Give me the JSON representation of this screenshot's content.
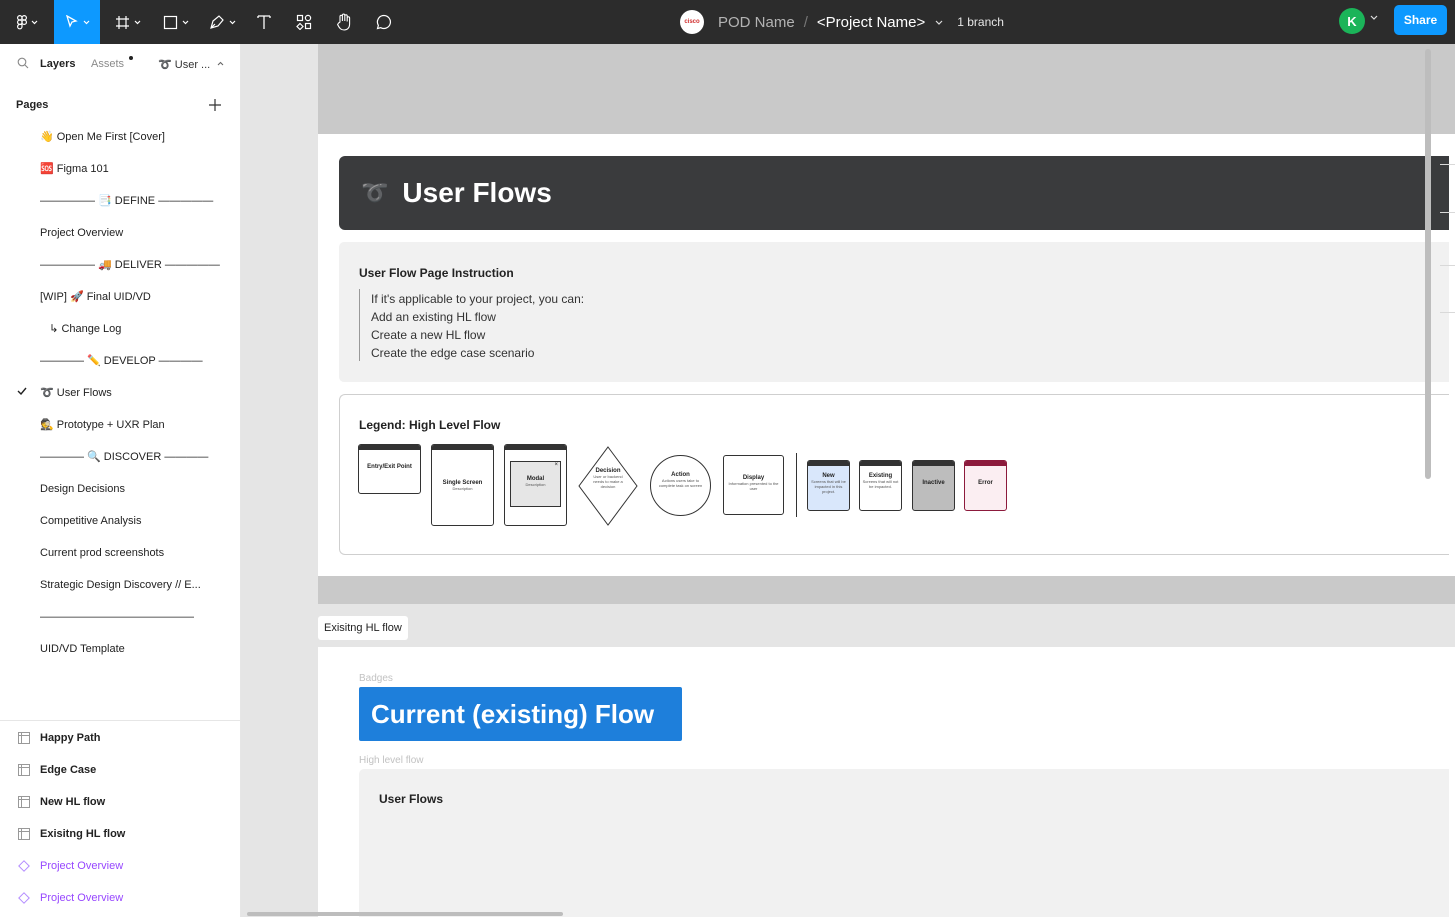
{
  "toolbar": {
    "file_name": "POD Name",
    "separator": "/",
    "project_name": "<Project Name>",
    "branch": "1 branch",
    "org_logo_text": "cisco",
    "avatar_initial": "K",
    "share_label": "Share"
  },
  "panel": {
    "tabs": {
      "layers": "Layers",
      "assets": "Assets",
      "current_page": "➰ User ..."
    },
    "pages_heading": "Pages",
    "pages": [
      "👋 Open Me First [Cover]",
      "🆘 Figma 101",
      "————— 📑 DEFINE —————",
      "Project Overview",
      "————— 🚚 DELIVER —————",
      "[WIP] 🚀 Final UID/VD",
      "   ↳ Change Log",
      "———— ✏️ DEVELOP ————",
      "➰ User Flows",
      "🕵 Prototype + UXR Plan",
      "———— 🔍 DISCOVER ————",
      "Design Decisions",
      "Competitive Analysis",
      "Current prod screenshots",
      "Strategic Design Discovery // E...",
      "——————————————",
      "UID/VD Template"
    ],
    "layers": [
      {
        "label": "Happy Path",
        "kind": "frame"
      },
      {
        "label": "Edge Case",
        "kind": "frame"
      },
      {
        "label": "New HL flow",
        "kind": "frame"
      },
      {
        "label": "Exisitng HL flow",
        "kind": "frame"
      },
      {
        "label": "Project Overview",
        "kind": "component"
      },
      {
        "label": "Project Overview",
        "kind": "component"
      }
    ]
  },
  "canvas": {
    "hero_icon": "➰",
    "hero_title": "User Flows",
    "instruction": {
      "title": "User Flow Page Instruction",
      "lines": [
        "If it's applicable to your project, you can:",
        "Add an existing HL flow",
        "Create a new HL flow",
        "Create the edge case scenario"
      ]
    },
    "legend": {
      "title": "Legend: High Level Flow",
      "items": {
        "entry": "Entry/Exit Point",
        "single": "Single Screen",
        "single_desc": "Description",
        "modal": "Modal",
        "modal_desc": "Description",
        "decision": "Decision",
        "decision_desc": "User or backend needs to make a decision",
        "action": "Action",
        "action_desc": "Actions users take to complete task on screen",
        "display": "Display",
        "display_desc": "Information presented to the user",
        "new": "New",
        "new_desc": "Screens that will be impacted in this project.",
        "existing": "Existing",
        "existing_desc": "Screens that will not be impacted.",
        "inactive": "Inactive",
        "error": "Error"
      }
    },
    "frame_label": "Exisitng HL flow",
    "badges_label": "Badges",
    "badge_title": "Current (existing) Flow",
    "hl_label": "High level flow",
    "user_flows_box_title": "User Flows"
  },
  "colors": {
    "toolbar_bg": "#2c2c2c",
    "accent": "#0d99ff",
    "badge_blue": "#1e7fdb",
    "component_purple": "#9747ff",
    "avatar_green": "#1bb459",
    "error_red": "#8c1a3c"
  }
}
